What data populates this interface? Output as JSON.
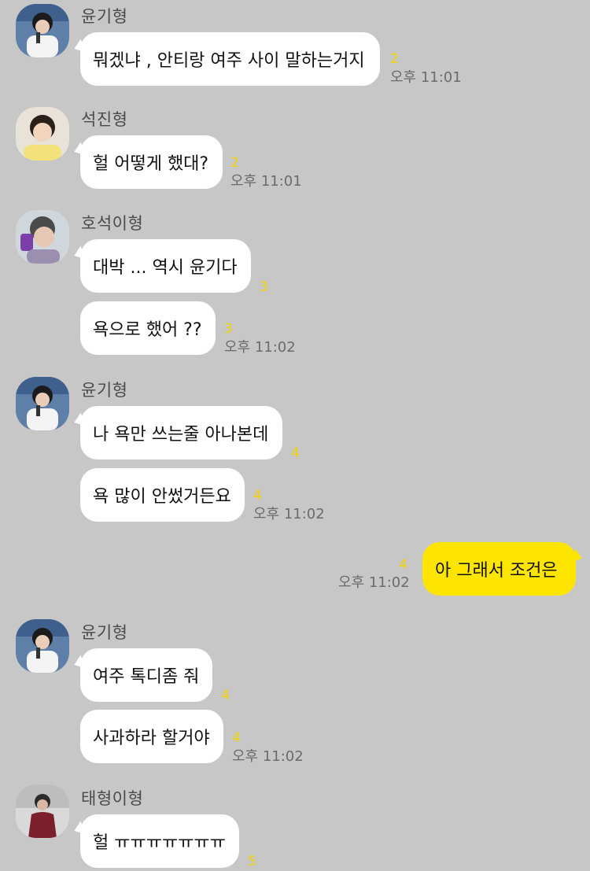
{
  "messages": [
    {
      "sender": "윤기형",
      "text": "뭐겠냐 , 안티랑 여주 사이 말하는거지",
      "unread": "2",
      "time": "오후 11:01"
    },
    {
      "sender": "석진형",
      "text": "헐 어떻게 했대?",
      "unread": "2",
      "time": "오후 11:01"
    },
    {
      "sender": "호석이형",
      "text": "대박 ... 역시 윤기다",
      "unread": "3"
    },
    {
      "text": "욕으로 했어 ??",
      "unread": "3",
      "time": "오후 11:02"
    },
    {
      "sender": "윤기형",
      "text": "나 욕만 쓰는줄 아나본데",
      "unread": "4"
    },
    {
      "text": "욕 많이 안썼거든요",
      "unread": "4",
      "time": "오후 11:02"
    },
    {
      "text": "아 그래서 조건은",
      "unread": "4",
      "time": "오후 11:02"
    },
    {
      "sender": "윤기형",
      "text": "여주 톡디좀 줘",
      "unread": "4"
    },
    {
      "text": "사과하라 할거야",
      "unread": "4",
      "time": "오후 11:02"
    },
    {
      "sender": "태형이형",
      "text": "헐 ㅠㅠㅠㅠㅠㅠㅠ",
      "unread": "5"
    }
  ],
  "colors": {
    "background": "#c7c7c7",
    "incoming_bubble": "#ffffff",
    "outgoing_bubble": "#fee500",
    "unread_count": "#f2d200",
    "timestamp": "#6b6b6b"
  }
}
